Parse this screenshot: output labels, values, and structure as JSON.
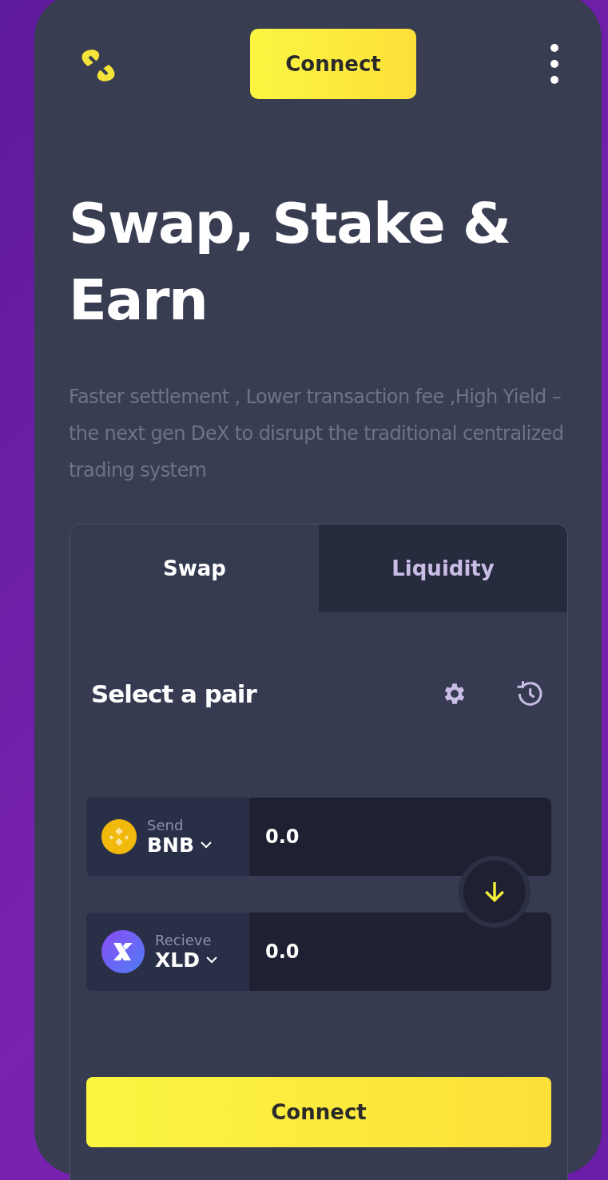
{
  "header": {
    "connect_button": "Connect"
  },
  "hero": {
    "title": "Swap, Stake & Earn",
    "subtitle": "Faster settlement , Lower transaction fee ,High Yield – the next gen DeX to disrupt the traditional centralized trading system"
  },
  "tabs": [
    {
      "label": "Swap",
      "selected": true
    },
    {
      "label": "Liquidity",
      "selected": false
    }
  ],
  "panel": {
    "title": "Select a pair"
  },
  "tokens": [
    {
      "label": "Send",
      "symbol": "BNB",
      "amount": "0.0"
    },
    {
      "label": "Recieve",
      "symbol": "XLD",
      "amount": "0.0"
    }
  ],
  "submit_button": "Connect"
}
